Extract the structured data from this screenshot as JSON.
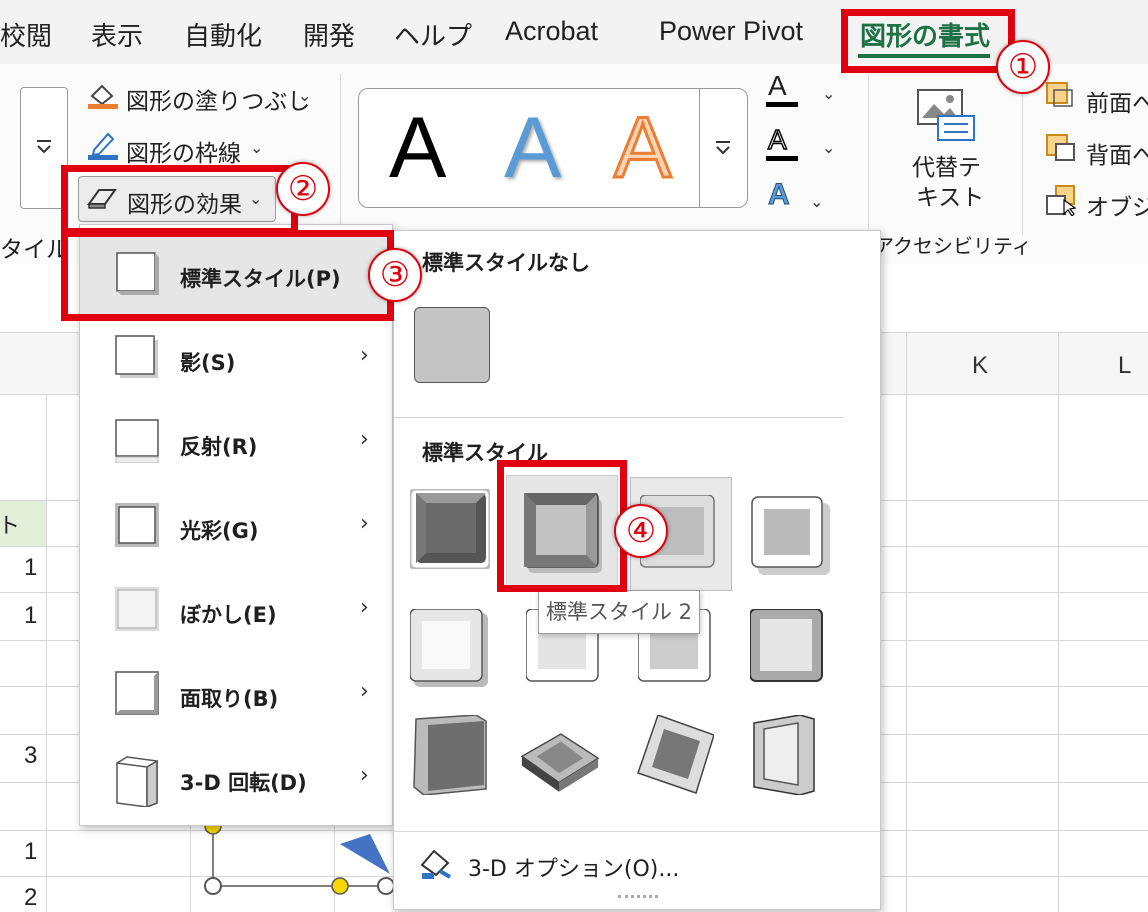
{
  "tabs": [
    "校閲",
    "表示",
    "自動化",
    "開発",
    "ヘルプ",
    "Acrobat",
    "Power Pivot",
    "図形の書式"
  ],
  "ribbon": {
    "fill_label": "図形の塗りつぶし",
    "outline_label": "図形の枠線",
    "effects_label": "図形の効果",
    "left_group_label": "タイル",
    "wordart_letters": [
      "A",
      "A",
      "A"
    ],
    "text_fill_letter": "A",
    "text_outline_letter": "A",
    "text_effects_letter": "A",
    "alt_text_label_line1": "代替テ",
    "alt_text_label_line2": "キスト",
    "accessibility_group": "アクセシビリティ",
    "bring_forward": "前面へ",
    "send_backward": "背面へ",
    "selection_pane": "オブジェ"
  },
  "sheet": {
    "col_k": "K",
    "col_l": "L",
    "header_cell": "ト",
    "cells": [
      "1",
      "1",
      "3",
      "1",
      "2"
    ]
  },
  "menu": {
    "items": [
      {
        "label": "標準スタイル(P)",
        "has_submenu": false
      },
      {
        "label": "影(S)",
        "has_submenu": true
      },
      {
        "label": "反射(R)",
        "has_submenu": true
      },
      {
        "label": "光彩(G)",
        "has_submenu": true
      },
      {
        "label": "ぼかし(E)",
        "has_submenu": true
      },
      {
        "label": "面取り(B)",
        "has_submenu": true
      },
      {
        "label": "3-D 回転(D)",
        "has_submenu": true
      }
    ],
    "arrow": "›"
  },
  "gallery": {
    "no_style_heading": "標準スタイルなし",
    "style_heading": "標準スタイル",
    "options_label": "3-D オプション(O)...",
    "tooltip": "標準スタイル 2"
  },
  "annotations": [
    "①",
    "②",
    "③",
    "④"
  ],
  "colors": {
    "accent_green": "#1e7145",
    "annotation_red": "#e0000f",
    "wordart_blue": "#5b9bd5",
    "wordart_orange": "#ed7d31"
  }
}
